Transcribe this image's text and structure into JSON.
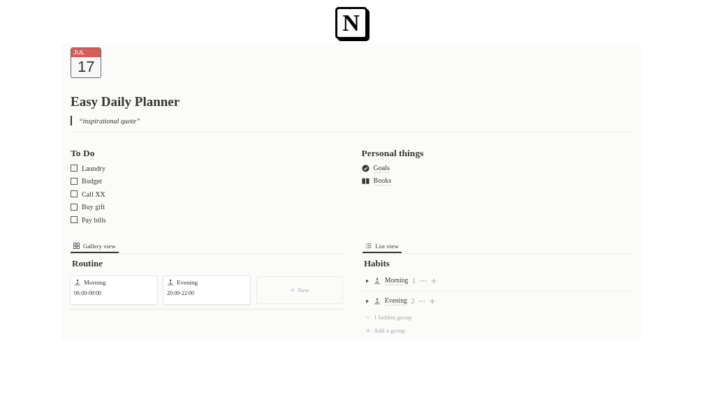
{
  "logo": {
    "letter": "N"
  },
  "page_icon": {
    "month": "JUL",
    "day": "17"
  },
  "title": "Easy Daily Planner",
  "quote": "“inspirational quote”",
  "todo": {
    "heading": "To Do",
    "items": [
      {
        "label": "Laundry",
        "checked": false
      },
      {
        "label": "Budget",
        "checked": false
      },
      {
        "label": "Call XX",
        "checked": false
      },
      {
        "label": "Buy gift",
        "checked": false
      },
      {
        "label": "Pay bills",
        "checked": false
      }
    ]
  },
  "personal": {
    "heading": "Personal things",
    "links": [
      {
        "label": "Goals",
        "kind": "check"
      },
      {
        "label": "Books",
        "kind": "book"
      }
    ]
  },
  "routine": {
    "tab": {
      "label": "Gallery view",
      "selected": true
    },
    "heading": "Routine",
    "cards": [
      {
        "name": "Morning",
        "time": "06:00-08:00"
      },
      {
        "name": "Evening",
        "time": "20:00-22:00"
      }
    ],
    "new_label": "New"
  },
  "habits": {
    "tab": {
      "label": "List view",
      "selected": true
    },
    "heading": "Habits",
    "groups": [
      {
        "name": "Morning",
        "count": "1",
        "expanded": false
      },
      {
        "name": "Evening",
        "count": "2",
        "expanded": false
      }
    ],
    "hidden": "1 hidden group",
    "add": "Add a group"
  }
}
